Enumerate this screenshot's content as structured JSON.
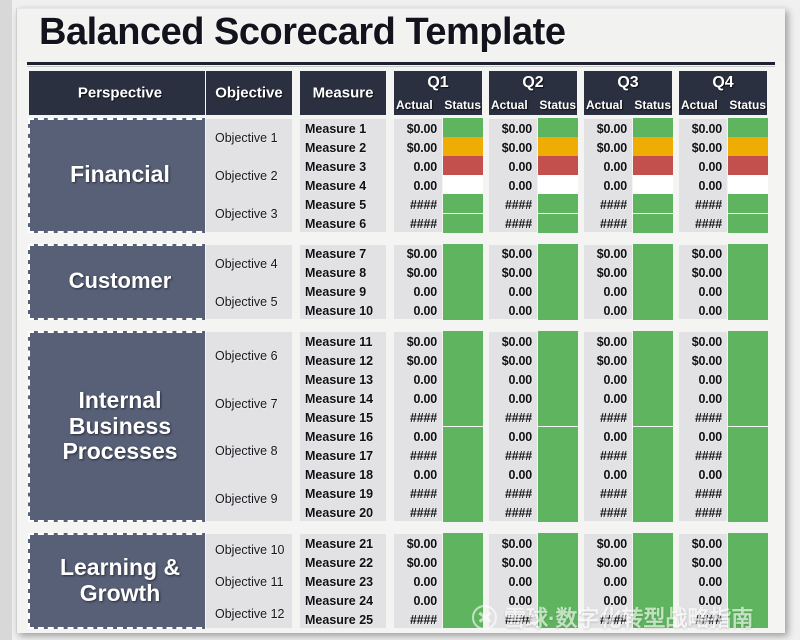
{
  "document": {
    "title": "Balanced Scorecard Template"
  },
  "columns": {
    "perspective": "Perspective",
    "objective": "Objective",
    "measure": "Measure",
    "quarters": [
      {
        "label": "Q1",
        "actual": "Actual",
        "status": "Status"
      },
      {
        "label": "Q2",
        "actual": "Actual",
        "status": "Status"
      },
      {
        "label": "Q3",
        "actual": "Actual",
        "status": "Status"
      },
      {
        "label": "Q4",
        "actual": "Actual",
        "status": "Status"
      }
    ]
  },
  "colors": {
    "header_bg": "#2b3040",
    "perspective_bg": "#586078",
    "cell_bg": "#e2e2e4",
    "status_green": "#5fb45f",
    "status_amber": "#efad04",
    "status_red": "#c4504d",
    "status_blank": "#ffffff",
    "sheet_bg": "#f4f4f2"
  },
  "sections": [
    {
      "perspective": "Financial",
      "objectives": [
        "Objective 1",
        "Objective 2",
        "Objective 3"
      ],
      "measures": [
        "Measure 1",
        "Measure 2",
        "Measure 3",
        "Measure 4",
        "Measure 5",
        "Measure 6"
      ],
      "actuals": [
        "$0.00",
        "$0.00",
        "0.00",
        "0.00",
        "####",
        "####"
      ],
      "statuses": [
        "green",
        "amber",
        "red",
        "blank",
        "green",
        "green"
      ]
    },
    {
      "perspective": "Customer",
      "objectives": [
        "Objective 4",
        "Objective 5"
      ],
      "measures": [
        "Measure 7",
        "Measure 8",
        "Measure 9",
        "Measure 10"
      ],
      "actuals": [
        "$0.00",
        "$0.00",
        "0.00",
        "0.00"
      ],
      "statuses": [
        "green",
        "green",
        "green",
        "green"
      ]
    },
    {
      "perspective": "Internal Business Processes",
      "objectives": [
        "Objective 6",
        "Objective 7",
        "Objective 8",
        "Objective 9"
      ],
      "measures": [
        "Measure 11",
        "Measure 12",
        "Measure 13",
        "Measure 14",
        "Measure 15",
        "Measure 16",
        "Measure 17",
        "Measure 18",
        "Measure 19",
        "Measure 20"
      ],
      "actuals": [
        "$0.00",
        "$0.00",
        "0.00",
        "0.00",
        "####",
        "0.00",
        "####",
        "0.00",
        "####",
        "####"
      ],
      "statuses": [
        "green",
        "green",
        "green",
        "green",
        "green",
        "green",
        "green",
        "green",
        "green",
        "green"
      ]
    },
    {
      "perspective": "Learning & Growth",
      "objectives": [
        "Objective 10",
        "Objective 11",
        "Objective 12"
      ],
      "measures": [
        "Measure 21",
        "Measure 22",
        "Measure 23",
        "Measure 24",
        "Measure 25"
      ],
      "actuals": [
        "$0.00",
        "$0.00",
        "0.00",
        "0.00",
        "####"
      ],
      "statuses": [
        "green",
        "green",
        "green",
        "green",
        "green"
      ]
    }
  ],
  "watermark": {
    "logo": "snowball-x-icon",
    "text": "雪球·数字化转型战略指南"
  }
}
